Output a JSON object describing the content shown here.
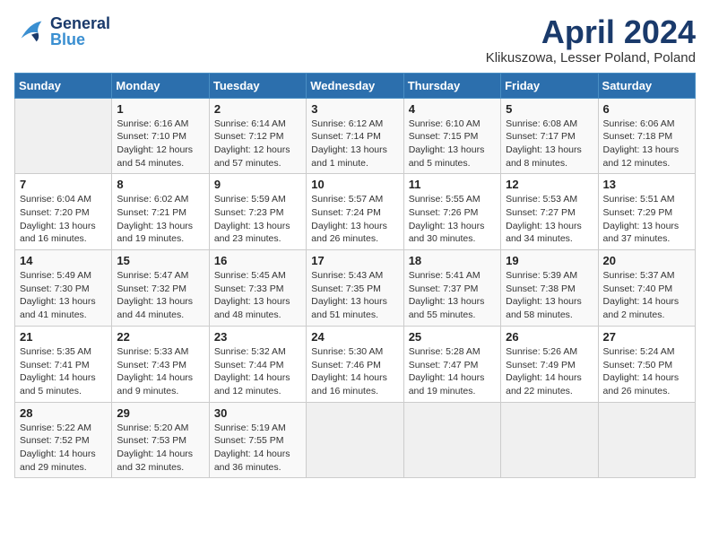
{
  "header": {
    "logo_general": "General",
    "logo_blue": "Blue",
    "title": "April 2024",
    "location": "Klikuszowa, Lesser Poland, Poland"
  },
  "weekdays": [
    "Sunday",
    "Monday",
    "Tuesday",
    "Wednesday",
    "Thursday",
    "Friday",
    "Saturday"
  ],
  "weeks": [
    [
      {
        "day": "",
        "info": ""
      },
      {
        "day": "1",
        "info": "Sunrise: 6:16 AM\nSunset: 7:10 PM\nDaylight: 12 hours\nand 54 minutes."
      },
      {
        "day": "2",
        "info": "Sunrise: 6:14 AM\nSunset: 7:12 PM\nDaylight: 12 hours\nand 57 minutes."
      },
      {
        "day": "3",
        "info": "Sunrise: 6:12 AM\nSunset: 7:14 PM\nDaylight: 13 hours\nand 1 minute."
      },
      {
        "day": "4",
        "info": "Sunrise: 6:10 AM\nSunset: 7:15 PM\nDaylight: 13 hours\nand 5 minutes."
      },
      {
        "day": "5",
        "info": "Sunrise: 6:08 AM\nSunset: 7:17 PM\nDaylight: 13 hours\nand 8 minutes."
      },
      {
        "day": "6",
        "info": "Sunrise: 6:06 AM\nSunset: 7:18 PM\nDaylight: 13 hours\nand 12 minutes."
      }
    ],
    [
      {
        "day": "7",
        "info": "Sunrise: 6:04 AM\nSunset: 7:20 PM\nDaylight: 13 hours\nand 16 minutes."
      },
      {
        "day": "8",
        "info": "Sunrise: 6:02 AM\nSunset: 7:21 PM\nDaylight: 13 hours\nand 19 minutes."
      },
      {
        "day": "9",
        "info": "Sunrise: 5:59 AM\nSunset: 7:23 PM\nDaylight: 13 hours\nand 23 minutes."
      },
      {
        "day": "10",
        "info": "Sunrise: 5:57 AM\nSunset: 7:24 PM\nDaylight: 13 hours\nand 26 minutes."
      },
      {
        "day": "11",
        "info": "Sunrise: 5:55 AM\nSunset: 7:26 PM\nDaylight: 13 hours\nand 30 minutes."
      },
      {
        "day": "12",
        "info": "Sunrise: 5:53 AM\nSunset: 7:27 PM\nDaylight: 13 hours\nand 34 minutes."
      },
      {
        "day": "13",
        "info": "Sunrise: 5:51 AM\nSunset: 7:29 PM\nDaylight: 13 hours\nand 37 minutes."
      }
    ],
    [
      {
        "day": "14",
        "info": "Sunrise: 5:49 AM\nSunset: 7:30 PM\nDaylight: 13 hours\nand 41 minutes."
      },
      {
        "day": "15",
        "info": "Sunrise: 5:47 AM\nSunset: 7:32 PM\nDaylight: 13 hours\nand 44 minutes."
      },
      {
        "day": "16",
        "info": "Sunrise: 5:45 AM\nSunset: 7:33 PM\nDaylight: 13 hours\nand 48 minutes."
      },
      {
        "day": "17",
        "info": "Sunrise: 5:43 AM\nSunset: 7:35 PM\nDaylight: 13 hours\nand 51 minutes."
      },
      {
        "day": "18",
        "info": "Sunrise: 5:41 AM\nSunset: 7:37 PM\nDaylight: 13 hours\nand 55 minutes."
      },
      {
        "day": "19",
        "info": "Sunrise: 5:39 AM\nSunset: 7:38 PM\nDaylight: 13 hours\nand 58 minutes."
      },
      {
        "day": "20",
        "info": "Sunrise: 5:37 AM\nSunset: 7:40 PM\nDaylight: 14 hours\nand 2 minutes."
      }
    ],
    [
      {
        "day": "21",
        "info": "Sunrise: 5:35 AM\nSunset: 7:41 PM\nDaylight: 14 hours\nand 5 minutes."
      },
      {
        "day": "22",
        "info": "Sunrise: 5:33 AM\nSunset: 7:43 PM\nDaylight: 14 hours\nand 9 minutes."
      },
      {
        "day": "23",
        "info": "Sunrise: 5:32 AM\nSunset: 7:44 PM\nDaylight: 14 hours\nand 12 minutes."
      },
      {
        "day": "24",
        "info": "Sunrise: 5:30 AM\nSunset: 7:46 PM\nDaylight: 14 hours\nand 16 minutes."
      },
      {
        "day": "25",
        "info": "Sunrise: 5:28 AM\nSunset: 7:47 PM\nDaylight: 14 hours\nand 19 minutes."
      },
      {
        "day": "26",
        "info": "Sunrise: 5:26 AM\nSunset: 7:49 PM\nDaylight: 14 hours\nand 22 minutes."
      },
      {
        "day": "27",
        "info": "Sunrise: 5:24 AM\nSunset: 7:50 PM\nDaylight: 14 hours\nand 26 minutes."
      }
    ],
    [
      {
        "day": "28",
        "info": "Sunrise: 5:22 AM\nSunset: 7:52 PM\nDaylight: 14 hours\nand 29 minutes."
      },
      {
        "day": "29",
        "info": "Sunrise: 5:20 AM\nSunset: 7:53 PM\nDaylight: 14 hours\nand 32 minutes."
      },
      {
        "day": "30",
        "info": "Sunrise: 5:19 AM\nSunset: 7:55 PM\nDaylight: 14 hours\nand 36 minutes."
      },
      {
        "day": "",
        "info": ""
      },
      {
        "day": "",
        "info": ""
      },
      {
        "day": "",
        "info": ""
      },
      {
        "day": "",
        "info": ""
      }
    ]
  ]
}
